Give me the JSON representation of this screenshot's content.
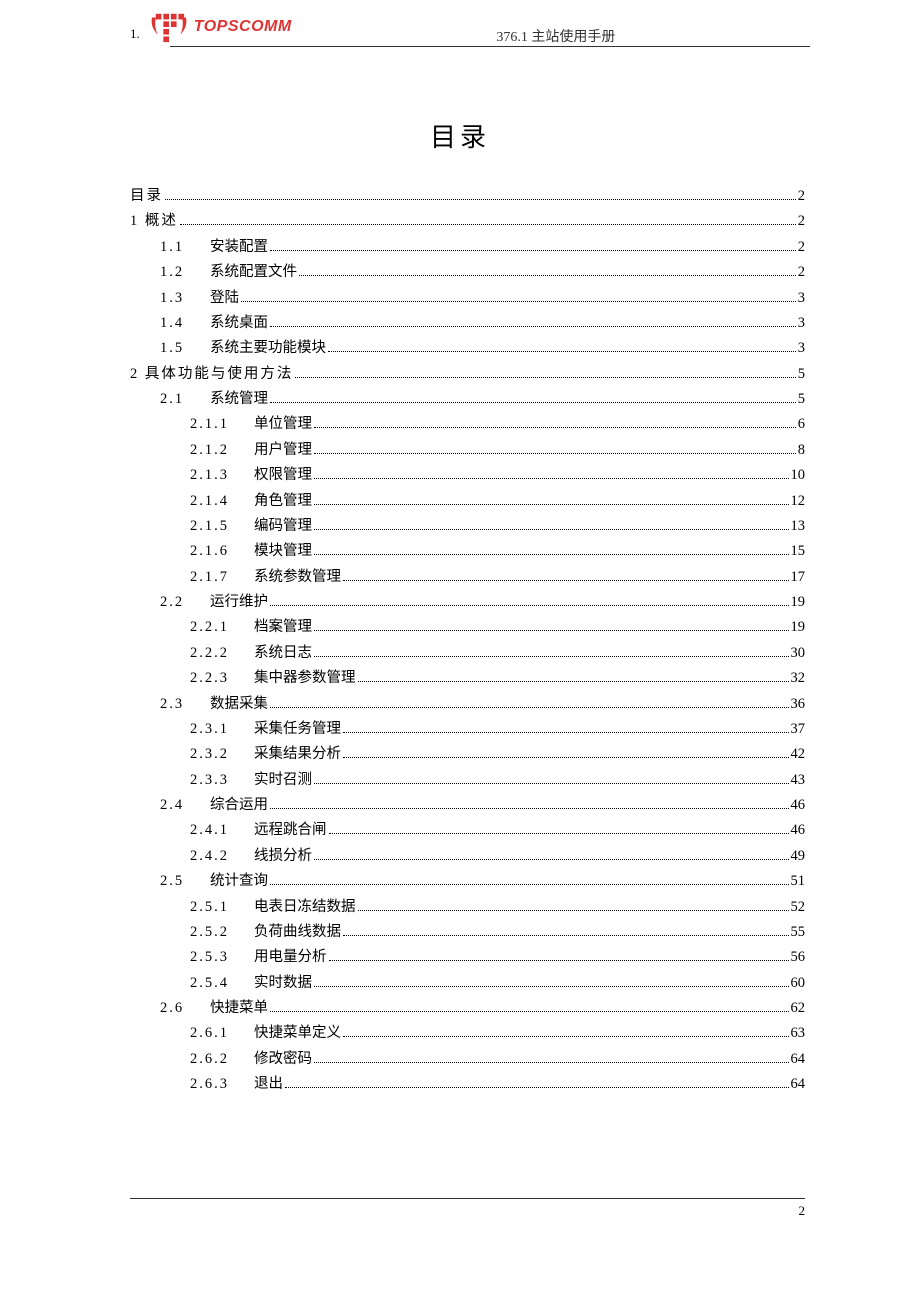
{
  "header": {
    "corner_label": "1.",
    "brand": "TOPSCOMM",
    "doc_title": "376.1 主站使用手册"
  },
  "toc_title": "目录",
  "toc": [
    {
      "level": 0,
      "num": "",
      "label": "目录",
      "page": "2"
    },
    {
      "level": 0,
      "num": "1",
      "label": "概述",
      "page": "2",
      "merge": true
    },
    {
      "level": 1,
      "num": "1.1",
      "label": "安装配置",
      "page": "2"
    },
    {
      "level": 1,
      "num": "1.2",
      "label": "系统配置文件",
      "page": "2"
    },
    {
      "level": 1,
      "num": "1.3",
      "label": "登陆",
      "page": "3"
    },
    {
      "level": 1,
      "num": "1.4",
      "label": "系统桌面",
      "page": "3"
    },
    {
      "level": 1,
      "num": "1.5",
      "label": "系统主要功能模块",
      "page": "3"
    },
    {
      "level": 0,
      "num": "2",
      "label": "具体功能与使用方法",
      "page": "5",
      "merge": true
    },
    {
      "level": 1,
      "num": "2.1",
      "label": "系统管理",
      "page": "5"
    },
    {
      "level": 2,
      "num": "2.1.1",
      "label": "单位管理",
      "page": "6"
    },
    {
      "level": 2,
      "num": "2.1.2",
      "label": "用户管理",
      "page": "8"
    },
    {
      "level": 2,
      "num": "2.1.3",
      "label": "权限管理",
      "page": "10"
    },
    {
      "level": 2,
      "num": "2.1.4",
      "label": "角色管理",
      "page": "12"
    },
    {
      "level": 2,
      "num": "2.1.5",
      "label": "编码管理",
      "page": "13"
    },
    {
      "level": 2,
      "num": "2.1.6",
      "label": "模块管理",
      "page": "15"
    },
    {
      "level": 2,
      "num": "2.1.7",
      "label": "系统参数管理",
      "page": "17"
    },
    {
      "level": 1,
      "num": "2.2",
      "label": "运行维护",
      "page": "19"
    },
    {
      "level": 2,
      "num": "2.2.1",
      "label": "档案管理",
      "page": "19"
    },
    {
      "level": 2,
      "num": "2.2.2",
      "label": "系统日志",
      "page": "30"
    },
    {
      "level": 2,
      "num": "2.2.3",
      "label": "集中器参数管理",
      "page": "32"
    },
    {
      "level": 1,
      "num": "2.3",
      "label": "数据采集",
      "page": "36"
    },
    {
      "level": 2,
      "num": "2.3.1",
      "label": "采集任务管理",
      "page": "37"
    },
    {
      "level": 2,
      "num": "2.3.2",
      "label": "采集结果分析",
      "page": "42"
    },
    {
      "level": 2,
      "num": "2.3.3",
      "label": "实时召测",
      "page": "43"
    },
    {
      "level": 1,
      "num": "2.4",
      "label": "综合运用",
      "page": "46"
    },
    {
      "level": 2,
      "num": "2.4.1",
      "label": "远程跳合闸",
      "page": "46"
    },
    {
      "level": 2,
      "num": "2.4.2",
      "label": "线损分析",
      "page": "49"
    },
    {
      "level": 1,
      "num": "2.5",
      "label": "统计查询",
      "page": "51"
    },
    {
      "level": 2,
      "num": "2.5.1",
      "label": "电表日冻结数据",
      "page": "52"
    },
    {
      "level": 2,
      "num": "2.5.2",
      "label": "负荷曲线数据",
      "page": "55"
    },
    {
      "level": 2,
      "num": "2.5.3",
      "label": "用电量分析",
      "page": "56"
    },
    {
      "level": 2,
      "num": "2.5.4",
      "label": "实时数据",
      "page": "60"
    },
    {
      "level": 1,
      "num": "2.6",
      "label": "快捷菜单",
      "page": "62"
    },
    {
      "level": 2,
      "num": "2.6.1",
      "label": "快捷菜单定义",
      "page": "63"
    },
    {
      "level": 2,
      "num": "2.6.2",
      "label": "修改密码",
      "page": "64"
    },
    {
      "level": 2,
      "num": "2.6.3",
      "label": "退出",
      "page": "64"
    }
  ],
  "footer_page": "2"
}
